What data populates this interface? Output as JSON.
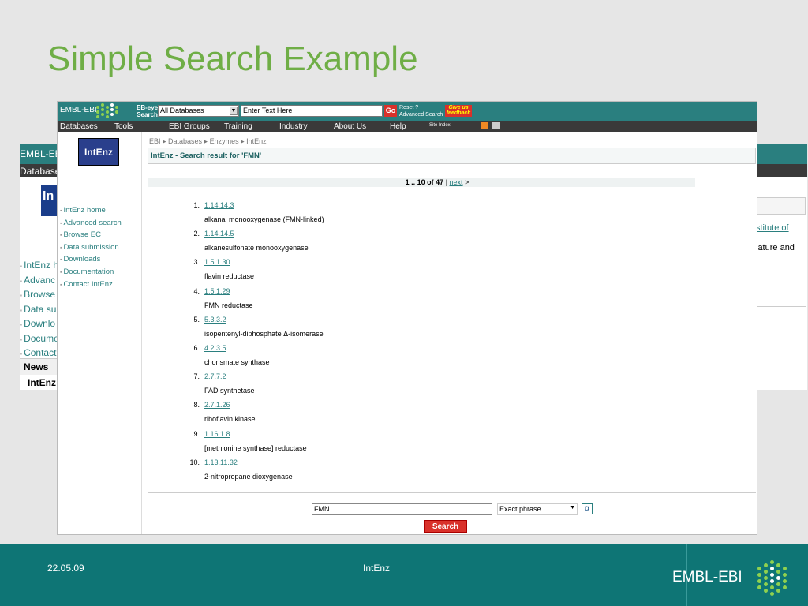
{
  "slide": {
    "title": "Simple Search Example",
    "footer_date": "22.05.09",
    "footer_center": "IntEnz",
    "footer_brand": "EMBL-EBI"
  },
  "bg_page": {
    "logo": "EMBL-EBI",
    "nav_label": "Database",
    "logo_text": "In",
    "links": [
      "IntEnz h",
      "Advanc",
      "Browse",
      "Data su",
      "Downlo",
      "Docume",
      "Contact"
    ],
    "news_header": "News",
    "news_item": "IntEnz",
    "right_link": "stitute of",
    "right_text": "lature and"
  },
  "header": {
    "logo": "EMBL-EBI",
    "ebeye_line1": "EB-eye",
    "ebeye_line2": "Search",
    "db_select": "All Databases",
    "search_placeholder": "Enter Text Here",
    "go": "Go",
    "reset": "Reset",
    "help_icon": "?",
    "advanced": "Advanced Search",
    "feedback_line1": "Give us",
    "feedback_line2": "feedback"
  },
  "nav": {
    "items": [
      "Databases",
      "Tools",
      "EBI Groups",
      "Training",
      "Industry",
      "About Us",
      "Help"
    ],
    "site_index": "Site Index"
  },
  "sidebar": {
    "logo": "IntEnz",
    "links": [
      "IntEnz home",
      "Advanced search",
      "Browse EC",
      "Data submission",
      "Downloads",
      "Documentation",
      "Contact IntEnz"
    ]
  },
  "main": {
    "breadcrumb": "EBI ▸ Databases ▸ Enzymes ▸ IntEnz",
    "title": "IntEnz - Search result for 'FMN'",
    "pager_range": "1 .. 10 of 47",
    "pager_sep": "|",
    "pager_next": "next",
    "pager_arrow": ">",
    "results": [
      {
        "num": "1.",
        "ec": "1.14.14.3",
        "name": "alkanal monooxygenase (FMN-linked)"
      },
      {
        "num": "2.",
        "ec": "1.14.14.5",
        "name": "alkanesulfonate monooxygenase"
      },
      {
        "num": "3.",
        "ec": "1.5.1.30",
        "name": "flavin reductase"
      },
      {
        "num": "4.",
        "ec": "1.5.1.29",
        "name": "FMN reductase"
      },
      {
        "num": "5.",
        "ec": "5.3.3.2",
        "name": "isopentenyl-diphosphate Δ-isomerase"
      },
      {
        "num": "6.",
        "ec": "4.2.3.5",
        "name": "chorismate synthase"
      },
      {
        "num": "7.",
        "ec": "2.7.7.2",
        "name": "FAD synthetase"
      },
      {
        "num": "8.",
        "ec": "2.7.1.26",
        "name": "riboflavin kinase"
      },
      {
        "num": "9.",
        "ec": "1.16.1.8",
        "name": "[methionine synthase] reductase"
      },
      {
        "num": "10.",
        "ec": "1.13.11.32",
        "name": "2-nitropropane dioxygenase"
      }
    ],
    "query_value": "FMN",
    "query_mode": "Exact phrase",
    "alpha": "α",
    "search_button": "Search"
  },
  "colors": {
    "accent_teal": "#2a7f7f",
    "title_green": "#6fae46",
    "button_red": "#d9312b",
    "footer_teal": "#0e7575"
  }
}
